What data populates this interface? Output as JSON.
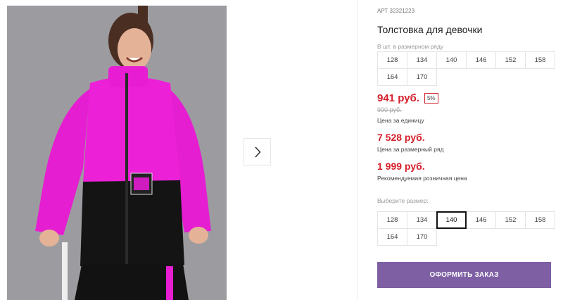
{
  "product": {
    "art_label": "АРТ",
    "art_number": "32321223",
    "title": "Толстовка для девочки"
  },
  "size_range": {
    "label": "В шт. в размерном ряду",
    "sizes": [
      "128",
      "134",
      "140",
      "146",
      "152",
      "158",
      "164",
      "170"
    ]
  },
  "pricing": {
    "unit_price": "941 руб.",
    "discount": "5%",
    "old_price": "990 руб.",
    "unit_note": "Цена за единицу",
    "range_price": "7 528 руб.",
    "range_note": "Цена за размерный ряд",
    "retail_price": "1 999 руб.",
    "retail_note": "Рекомендуемая розничная цена"
  },
  "size_picker": {
    "label": "Выберите размер:",
    "sizes": [
      "128",
      "134",
      "140",
      "146",
      "152",
      "158",
      "164",
      "170"
    ],
    "selected": "140"
  },
  "actions": {
    "order_label": "ОФОРМИТЬ ЗАКАЗ"
  },
  "colors": {
    "price": "#d6202c",
    "order_button": "#7e5fa4"
  },
  "icons": {
    "next": "chevron-right-icon"
  }
}
